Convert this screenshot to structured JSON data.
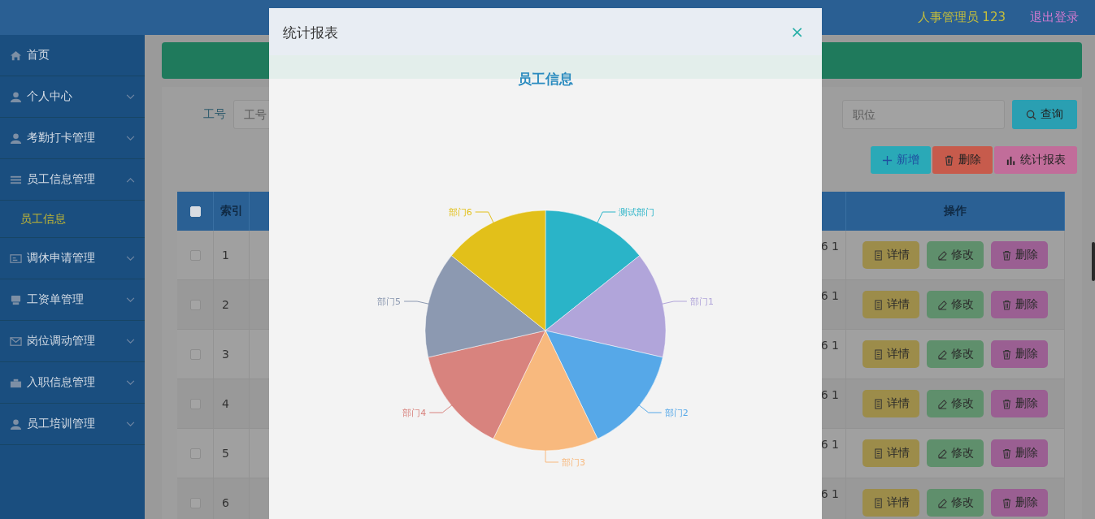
{
  "header": {
    "user": "人事管理员 123",
    "logout": "退出登录"
  },
  "sidebar": {
    "items": [
      {
        "label": "首页"
      },
      {
        "label": "个人中心",
        "expanded": false
      },
      {
        "label": "考勤打卡管理",
        "expanded": false
      },
      {
        "label": "员工信息管理",
        "expanded": true,
        "children": [
          {
            "label": "员工信息",
            "selected": true
          }
        ]
      },
      {
        "label": "调休申请管理",
        "expanded": false
      },
      {
        "label": "工资单管理",
        "expanded": false
      },
      {
        "label": "岗位调动管理",
        "expanded": false
      },
      {
        "label": "入职信息管理",
        "expanded": false
      },
      {
        "label": "员工培训管理",
        "expanded": false
      }
    ]
  },
  "search": {
    "fields": [
      {
        "label": "工号",
        "placeholder": "工号"
      },
      {
        "placeholder": "职位"
      }
    ],
    "button": "查询"
  },
  "actions": [
    {
      "kind": "add",
      "label": "新增"
    },
    {
      "kind": "delete",
      "label": "删除"
    },
    {
      "kind": "chart",
      "label": "统计报表"
    }
  ],
  "table": {
    "select_all": {
      "checked": false
    },
    "columns": [
      {
        "label": "索引"
      },
      {
        "label": "操作"
      }
    ],
    "rows": [
      {
        "checked": false,
        "index": "1",
        "date_part": "6 1",
        "actions": [
          "详情",
          "修改",
          "删除"
        ]
      },
      {
        "checked": false,
        "index": "2",
        "date_part": "6 1",
        "actions": [
          "详情",
          "修改",
          "删除"
        ]
      },
      {
        "checked": false,
        "index": "3",
        "date_part": "6 1",
        "actions": [
          "详情",
          "修改",
          "删除"
        ]
      },
      {
        "checked": false,
        "index": "4",
        "date_part": "6 1",
        "actions": [
          "详情",
          "修改",
          "删除"
        ]
      },
      {
        "checked": false,
        "index": "5",
        "date_part": "6 1",
        "actions": [
          "详情",
          "修改",
          "删除"
        ]
      },
      {
        "checked": false,
        "index": "6",
        "date_part": "6 1",
        "actions": [
          "详情",
          "修改",
          "删除"
        ]
      }
    ]
  },
  "modal": {
    "title": "统计报表",
    "close": "×",
    "chart_title": "员工信息",
    "slices": [
      {
        "label": "测试部门",
        "color": "#2ab4c8"
      },
      {
        "label": "部门1",
        "color": "#b1a5da"
      },
      {
        "label": "部门2",
        "color": "#56a8e8"
      },
      {
        "label": "部门3",
        "color": "#f8b97e"
      },
      {
        "label": "部门4",
        "color": "#d8837e"
      },
      {
        "label": "部门5",
        "color": "#8c99b1"
      },
      {
        "label": "部门6",
        "color": "#e2c01a"
      }
    ]
  }
}
